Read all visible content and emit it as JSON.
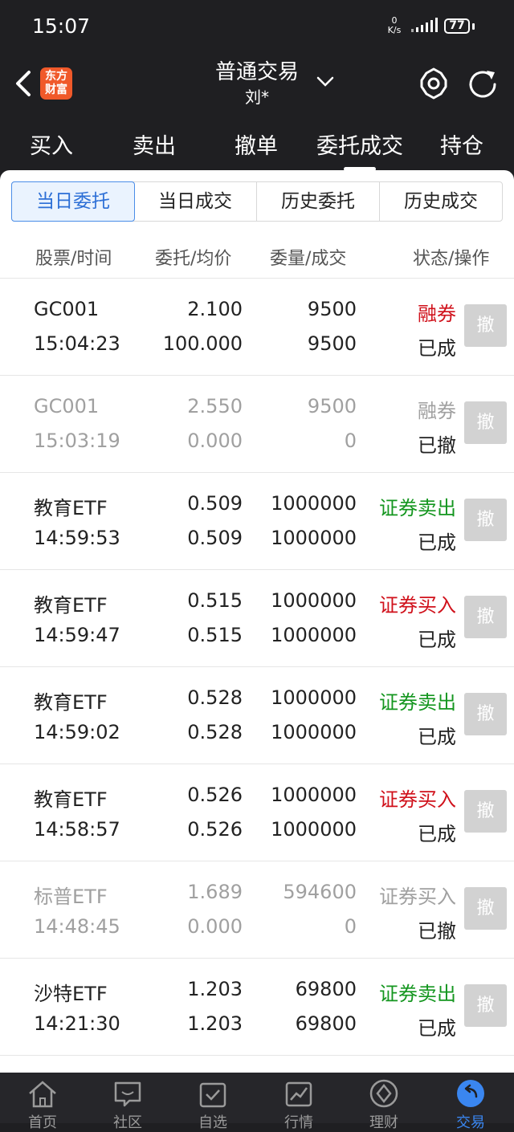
{
  "status_bar": {
    "time": "15:07",
    "net_speed_value": "0",
    "net_speed_unit": "K/s",
    "battery": "77"
  },
  "header": {
    "logo": "东方财富",
    "title": "普通交易",
    "account": "刘*"
  },
  "top_tabs": [
    "买入",
    "卖出",
    "撤单",
    "委托成交",
    "持仓"
  ],
  "active_top_tab": "委托成交",
  "segments": [
    "当日委托",
    "当日成交",
    "历史委托",
    "历史成交"
  ],
  "active_segment": "当日委托",
  "columns": [
    "股票/时间",
    "委托/均价",
    "委量/成交",
    "状态/操作"
  ],
  "cancel_label": "撤",
  "orders": [
    {
      "name": "GC001",
      "time": "15:04:23",
      "price": "2.100",
      "avg": "100.000",
      "qty": "9500",
      "filled": "9500",
      "type": "融券",
      "type_color": "red",
      "state": "已成",
      "dim": false
    },
    {
      "name": "GC001",
      "time": "15:03:19",
      "price": "2.550",
      "avg": "0.000",
      "qty": "9500",
      "filled": "0",
      "type": "融券",
      "type_color": "gray",
      "state": "已撤",
      "dim": true
    },
    {
      "name": "教育ETF",
      "time": "14:59:53",
      "price": "0.509",
      "avg": "0.509",
      "qty": "1000000",
      "filled": "1000000",
      "type": "证券卖出",
      "type_color": "green",
      "state": "已成",
      "dim": false
    },
    {
      "name": "教育ETF",
      "time": "14:59:47",
      "price": "0.515",
      "avg": "0.515",
      "qty": "1000000",
      "filled": "1000000",
      "type": "证券买入",
      "type_color": "red",
      "state": "已成",
      "dim": false
    },
    {
      "name": "教育ETF",
      "time": "14:59:02",
      "price": "0.528",
      "avg": "0.528",
      "qty": "1000000",
      "filled": "1000000",
      "type": "证券卖出",
      "type_color": "green",
      "state": "已成",
      "dim": false
    },
    {
      "name": "教育ETF",
      "time": "14:58:57",
      "price": "0.526",
      "avg": "0.526",
      "qty": "1000000",
      "filled": "1000000",
      "type": "证券买入",
      "type_color": "red",
      "state": "已成",
      "dim": false
    },
    {
      "name": "标普ETF",
      "time": "14:48:45",
      "price": "1.689",
      "avg": "0.000",
      "qty": "594600",
      "filled": "0",
      "type": "证券买入",
      "type_color": "gray",
      "state": "已撤",
      "dim": true
    },
    {
      "name": "沙特ETF",
      "time": "14:21:30",
      "price": "1.203",
      "avg": "1.203",
      "qty": "69800",
      "filled": "69800",
      "type": "证券卖出",
      "type_color": "green",
      "state": "已成",
      "dim": false
    }
  ],
  "bottom_nav": [
    {
      "label": "首页",
      "icon": "home-icon"
    },
    {
      "label": "社区",
      "icon": "chat-icon"
    },
    {
      "label": "自选",
      "icon": "watchlist-icon"
    },
    {
      "label": "行情",
      "icon": "market-chart-icon"
    },
    {
      "label": "理财",
      "icon": "wealth-icon"
    },
    {
      "label": "交易",
      "icon": "trade-icon"
    }
  ],
  "active_nav": "交易",
  "colors": {
    "accent": "#3a86f0",
    "up_red": "#d0111b",
    "down_green": "#14961f",
    "logo": "#f0592a"
  }
}
